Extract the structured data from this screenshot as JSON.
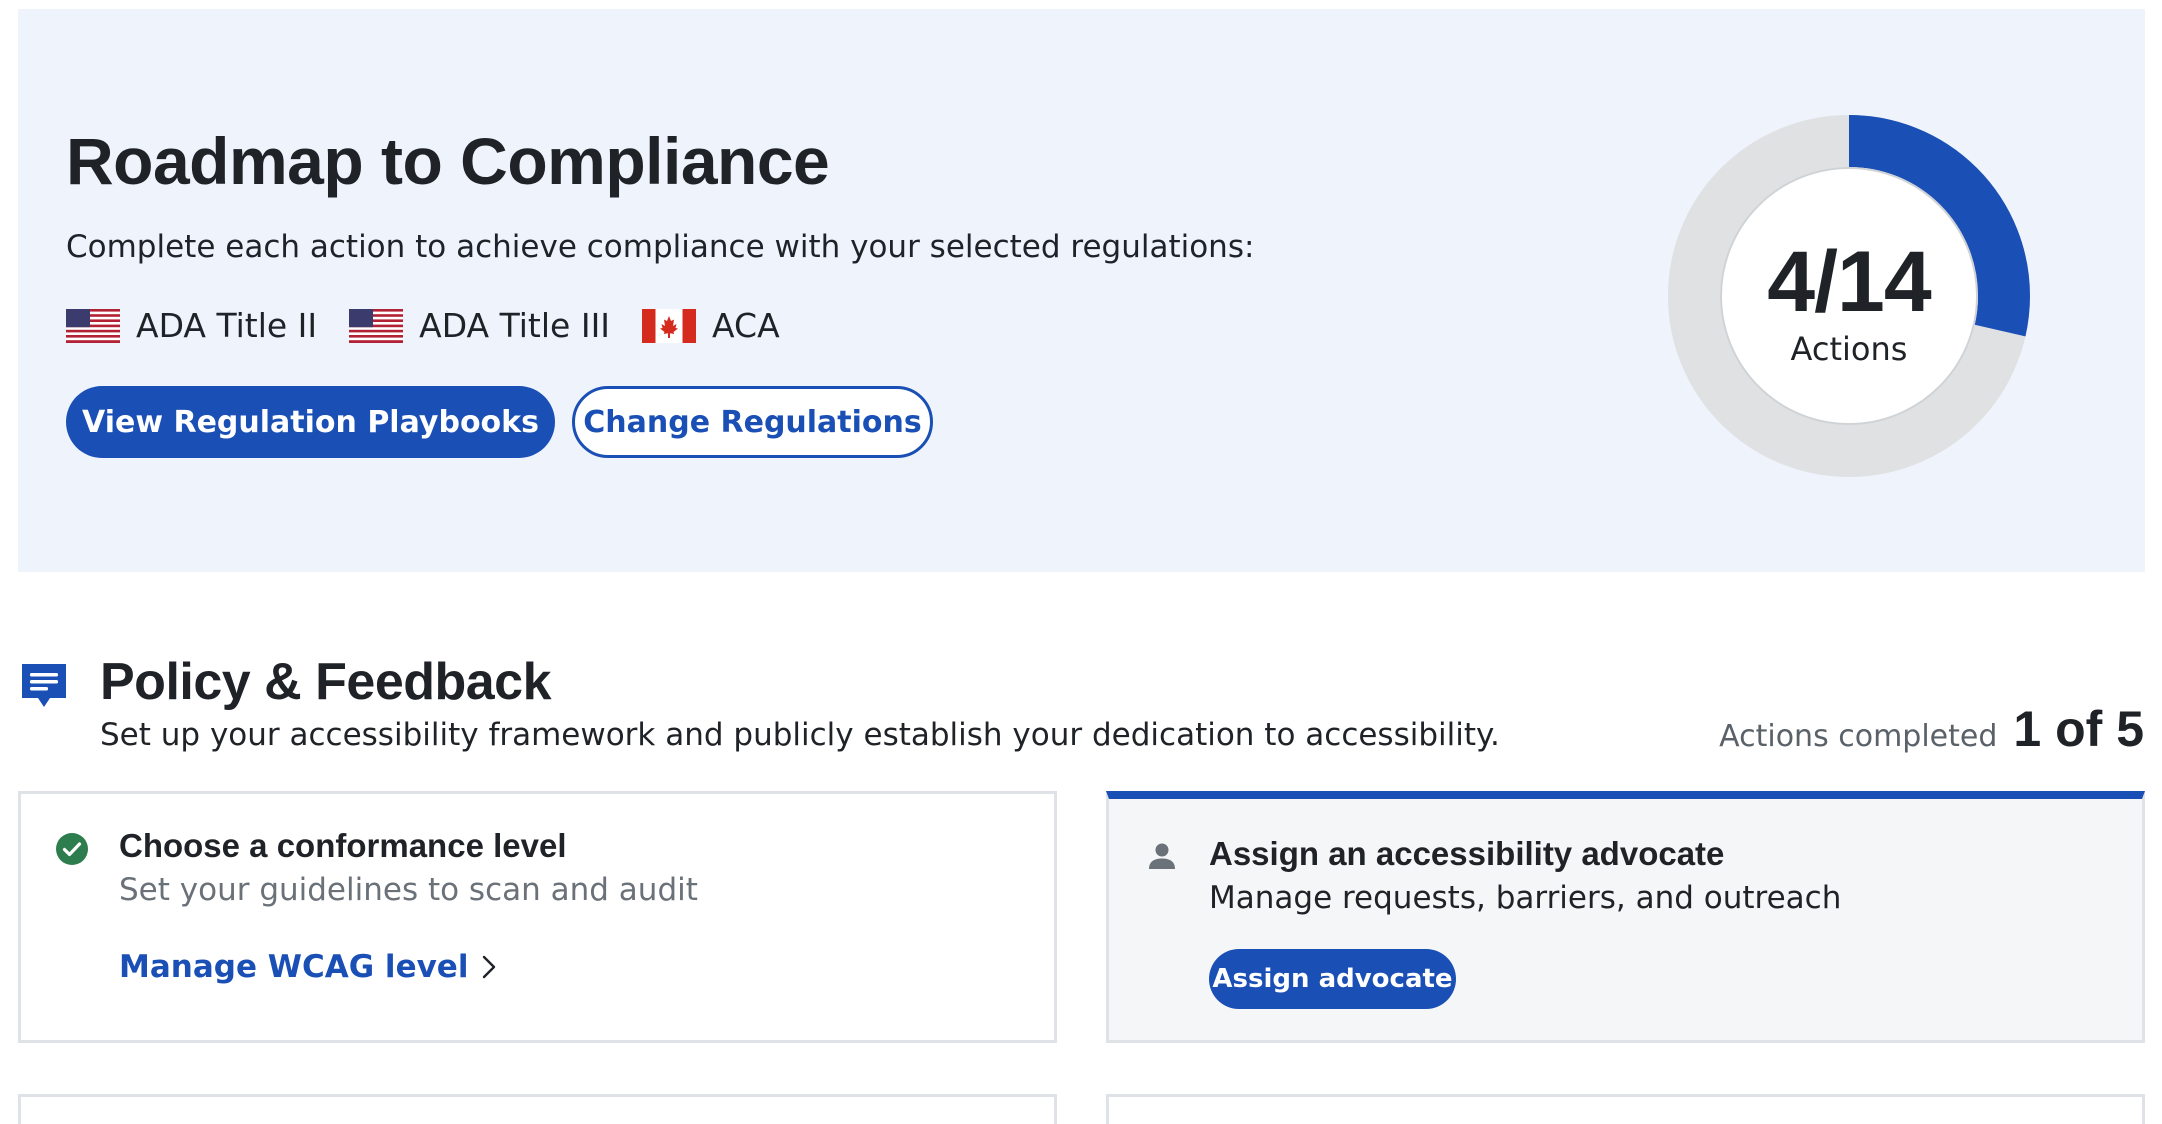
{
  "hero": {
    "title": "Roadmap to Compliance",
    "description": "Complete each action to achieve compliance with your selected regulations:",
    "regulations": [
      {
        "label": "ADA Title II",
        "flag": "us-flag-icon"
      },
      {
        "label": "ADA Title III",
        "flag": "us-flag-icon"
      },
      {
        "label": "ACA",
        "flag": "canada-flag-icon"
      }
    ],
    "primary_button": "View Regulation Playbooks",
    "secondary_button": "Change Regulations",
    "progress": {
      "value_text": "4/14",
      "label": "Actions",
      "completed": 4,
      "total": 14
    }
  },
  "section": {
    "icon": "message-icon",
    "title": "Policy & Feedback",
    "description": "Set up your accessibility framework and publicly establish your dedication to accessibility.",
    "progress_label": "Actions completed",
    "progress_value": "1 of 5"
  },
  "cards": [
    {
      "status": "completed",
      "icon": "check-circle-icon",
      "title": "Choose a conformance level",
      "description": "Set your guidelines to scan and audit",
      "action_label": "Manage WCAG level",
      "action_icon": "chevron-right-icon"
    },
    {
      "status": "active",
      "icon": "person-icon",
      "title": "Assign an accessibility advocate",
      "description": "Manage requests, barriers, and outreach",
      "action_label": "Assign advocate"
    }
  ],
  "colors": {
    "accent": "#1a4fb5",
    "hero_background": "#eef3fc",
    "donut_track": "#dfe1e3",
    "success": "#2e7d4f"
  }
}
